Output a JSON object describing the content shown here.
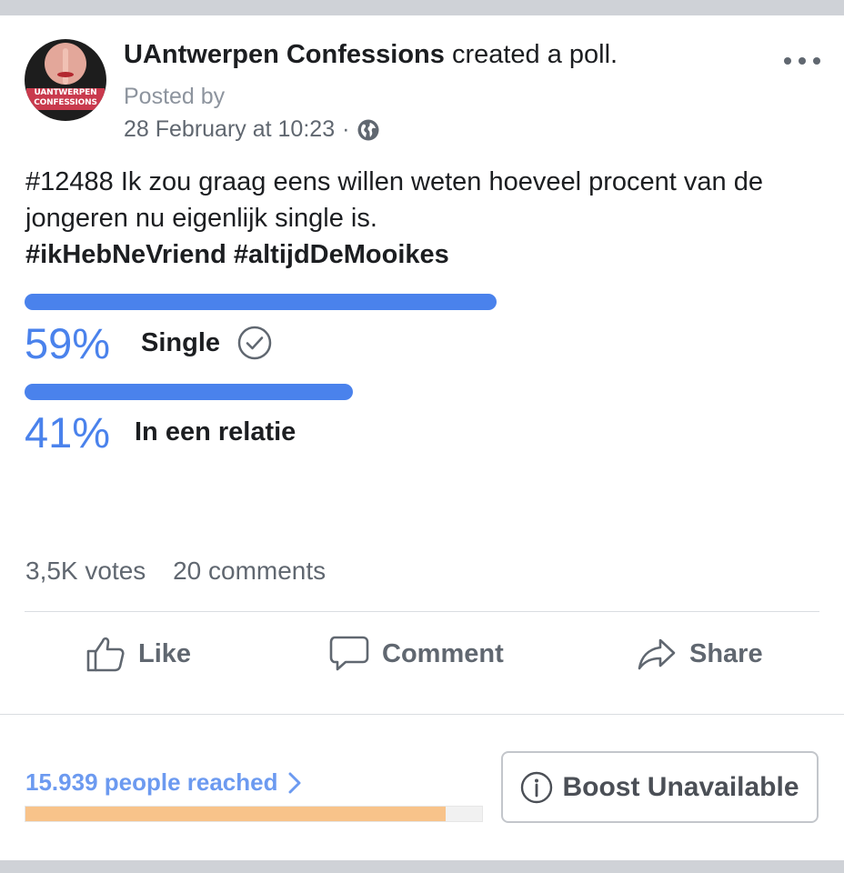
{
  "header": {
    "page_name": "UAntwerpen Confessions",
    "action_text": "created a poll.",
    "posted_by": "Posted by",
    "timestamp": "28 February at 10:23",
    "separator": "·",
    "privacy_icon": "globe-icon",
    "menu_icon": "more-options-icon"
  },
  "avatar": {
    "line1": "UANTWERPEN",
    "line2": "CONFESSIONS"
  },
  "post": {
    "text": "#12488 Ik zou graag eens willen weten hoeveel procent van de jongeren nu eigenlijk single is.",
    "hashtags": "#ikHebNeVriend #altijdDeMooikes"
  },
  "poll": {
    "options": [
      {
        "percent_label": "59%",
        "value": 0.59,
        "label": "Single",
        "selected": true
      },
      {
        "percent_label": "41%",
        "value": 0.41,
        "label": "In een relatie",
        "selected": false
      }
    ]
  },
  "stats": {
    "votes": "3,5K votes",
    "comments": "20 comments"
  },
  "actions": {
    "like": "Like",
    "comment": "Comment",
    "share": "Share"
  },
  "insights": {
    "reach_label": "15.939 people reached",
    "reach_fill_fraction": 0.92,
    "boost_label": "Boost Unavailable"
  },
  "colors": {
    "accent": "#4a82ec",
    "reach_bar": "#f8c38a",
    "muted_text": "#606770"
  }
}
